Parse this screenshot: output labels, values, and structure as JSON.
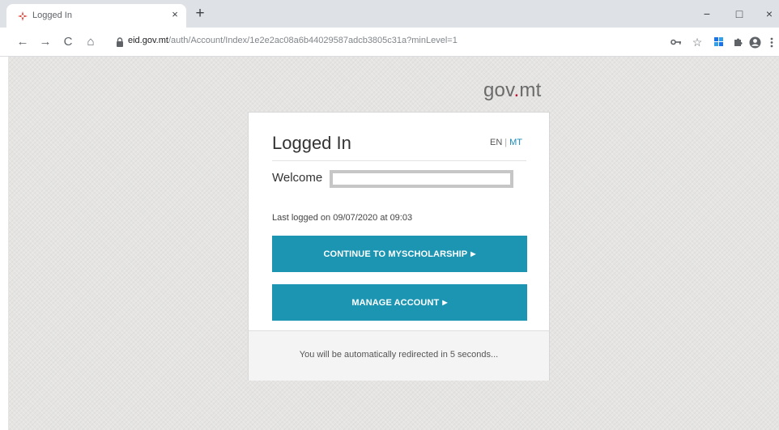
{
  "browser": {
    "tab": {
      "title": "Logged In",
      "close": "×"
    },
    "new_tab": "+",
    "window": {
      "minimize": "−",
      "maximize": "□",
      "close": "×"
    },
    "url": {
      "host": "eid.gov.mt",
      "path": "/auth/Account/Index/1e2e2ac08a6b44029587adcb3805c31a?minLevel=1"
    },
    "nav": {
      "back": "←",
      "forward": "→",
      "reload": "C",
      "home": "⌂"
    },
    "toolbar_icons": [
      "key-icon",
      "star-icon",
      "extension-icon",
      "puzzle-icon",
      "profile-icon",
      "menu-icon"
    ]
  },
  "page": {
    "brand": {
      "name": "gov",
      "dot": ".",
      "tld": "mt"
    },
    "card": {
      "title": "Logged In",
      "lang_en": "EN",
      "lang_sep": "|",
      "lang_mt": "MT",
      "welcome": "Welcome",
      "last_logged": "Last logged on 09/07/2020 at 09:03",
      "continue_button": "CONTINUE TO MYSCHOLARSHIP",
      "manage_button": "MANAGE ACCOUNT",
      "button_arrow": "▶",
      "redirect_notice": "You will be automatically redirected in 5 seconds..."
    }
  },
  "colors": {
    "accent": "#1c95b2",
    "brand_dot": "#c8102e",
    "lang_link": "#1a8ab3",
    "page_background": "#e5e4e2"
  }
}
